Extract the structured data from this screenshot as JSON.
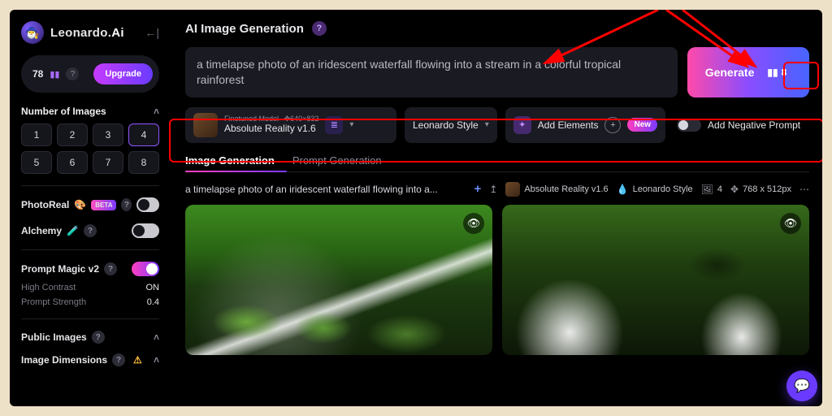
{
  "brand": {
    "name": "Leonardo.",
    "suffix": "Ai",
    "avatar_glyph": "🧙‍♂️"
  },
  "credits": {
    "count": "78",
    "upgrade_label": "Upgrade"
  },
  "sidebar": {
    "num_images": {
      "label": "Number of Images",
      "options": [
        "1",
        "2",
        "3",
        "4",
        "5",
        "6",
        "7",
        "8"
      ],
      "active_index": 3
    },
    "photoreal": {
      "label": "PhotoReal",
      "beta": "BETA"
    },
    "alchemy": {
      "label": "Alchemy"
    },
    "prompt_magic": {
      "label": "Prompt Magic v2",
      "high_contrast_label": "High Contrast",
      "high_contrast_value": "ON",
      "strength_label": "Prompt Strength",
      "strength_value": "0.4"
    },
    "public_images": {
      "label": "Public Images"
    },
    "image_dims": {
      "label": "Image Dimensions"
    }
  },
  "header": {
    "title": "AI Image Generation"
  },
  "prompt": "a timelapse photo of an iridescent waterfall flowing into a stream in a colorful tropical rainforest",
  "generate": {
    "label": "Generate",
    "count": "8"
  },
  "options": {
    "model_tag": "Finetuned Model",
    "model_name": "Absolute Reality v1.6",
    "model_dims": "640×832",
    "style": "Leonardo Style",
    "add_elements": "Add Elements",
    "new_badge": "New",
    "neg_prompt_label": "Add Negative Prompt"
  },
  "tabs": {
    "image_gen": "Image Generation",
    "prompt_gen": "Prompt Generation"
  },
  "result": {
    "prompt_display": "a timelapse photo of an iridescent waterfall flowing into a...",
    "model": "Absolute Reality v1.6",
    "style": "Leonardo Style",
    "count": "4",
    "dims": "768 x 512px"
  }
}
